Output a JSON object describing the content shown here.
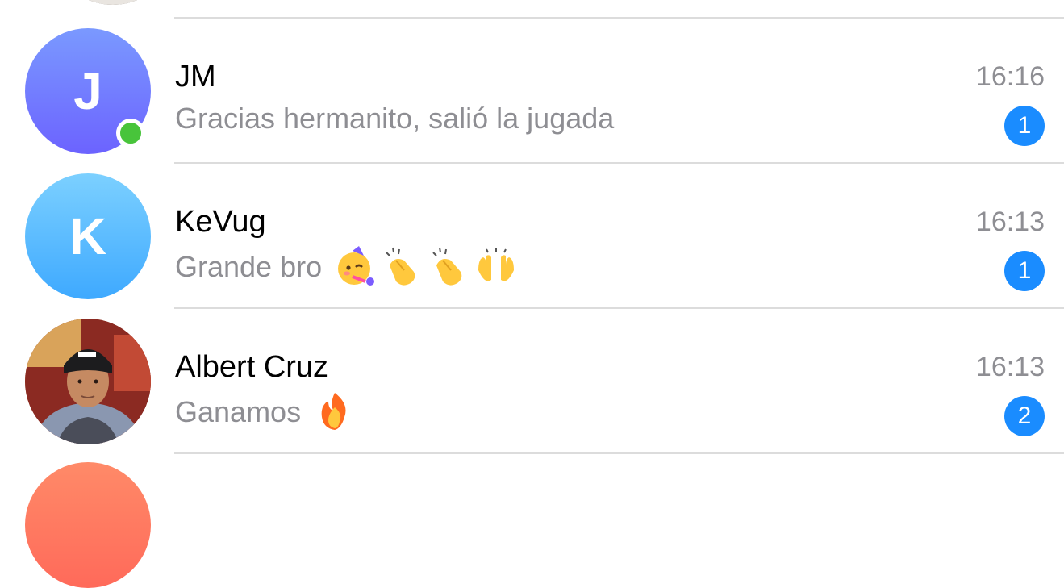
{
  "chats": [
    {
      "name": "JM",
      "initial": "J",
      "preview": "Gracias hermanito, salió la jugada",
      "time": "16:16",
      "unread": "1",
      "online": true,
      "avatar_color": "#6c63ff"
    },
    {
      "name": "KeVug",
      "initial": "K",
      "preview": "Grande bro",
      "emojis": [
        "partying-face-emoji",
        "clapping-hands-emoji",
        "clapping-hands-emoji",
        "raising-hands-emoji"
      ],
      "time": "16:13",
      "unread": "1",
      "online": false,
      "avatar_color": "#3ea9ff"
    },
    {
      "name": "Albert Cruz",
      "preview": "Ganamos",
      "emojis": [
        "fire-emoji"
      ],
      "time": "16:13",
      "unread": "2",
      "online": false,
      "avatar": "photo"
    }
  ],
  "colors": {
    "badge": "#1a8cff",
    "online": "#48c43b",
    "secondary_text": "#8e8e93",
    "divider": "#dcdcdc"
  }
}
